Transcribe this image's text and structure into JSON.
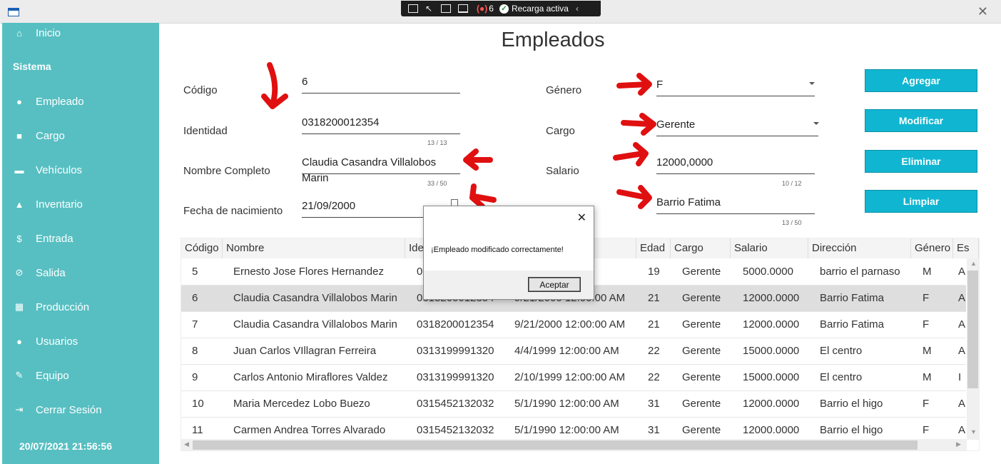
{
  "devbar": {
    "error_count": "6",
    "reload_label": "Recarga activa"
  },
  "sidebar": {
    "items": [
      {
        "label": "Inicio",
        "icon": "home-icon",
        "glyph": "⌂"
      },
      {
        "label": "Empleado",
        "icon": "person-icon",
        "glyph": "●"
      },
      {
        "label": "Cargo",
        "icon": "briefcase-icon",
        "glyph": "■"
      },
      {
        "label": "Vehículos",
        "icon": "truck-icon",
        "glyph": "▬"
      },
      {
        "label": "Inventario",
        "icon": "inventory-icon",
        "glyph": "▲"
      },
      {
        "label": "Entrada",
        "icon": "dollar-icon",
        "glyph": "$"
      },
      {
        "label": "Salida",
        "icon": "no-money-icon",
        "glyph": "⊘"
      },
      {
        "label": "Producción",
        "icon": "factory-icon",
        "glyph": "▦"
      },
      {
        "label": "Usuarios",
        "icon": "user-icon",
        "glyph": "●"
      },
      {
        "label": "Equipo",
        "icon": "wrench-icon",
        "glyph": "✎"
      },
      {
        "label": "Cerrar Sesión",
        "icon": "logout-icon",
        "glyph": "⇥"
      }
    ],
    "section_title": "Sistema",
    "datetime": "20/07/2021 21:56:56",
    "bg_color": "#57bfc2"
  },
  "page": {
    "title": "Empleados"
  },
  "form": {
    "codigo": {
      "label": "Código",
      "value": "6"
    },
    "identidad": {
      "label": "Identidad",
      "value": "0318200012354",
      "counter": "13 / 13"
    },
    "nombre": {
      "label": "Nombre Completo",
      "value": "Claudia Casandra Villalobos Marin",
      "counter": "33 / 50"
    },
    "fecha": {
      "label": "Fecha de nacimiento",
      "value": "21/09/2000"
    },
    "genero": {
      "label": "Género",
      "value": "F"
    },
    "cargo": {
      "label": "Cargo",
      "value": "Gerente"
    },
    "salario": {
      "label": "Salario",
      "value": "12000,0000",
      "counter": "10 / 12"
    },
    "direccion": {
      "value": "Barrio Fatima",
      "counter": "13 / 50"
    }
  },
  "buttons": {
    "agregar": "Agregar",
    "modificar": "Modificar",
    "eliminar": "Eliminar",
    "limpiar": "Limpiar",
    "color": "#10b6d1"
  },
  "table": {
    "headers": [
      "Código",
      "Nombre",
      "Ide",
      "Edad",
      "Cargo",
      "Salario",
      "Dirección",
      "Género",
      "Es"
    ],
    "rows": [
      {
        "codigo": "5",
        "nombre": "Ernesto Jose  Flores Hernandez",
        "identidad": "0",
        "fecha": ":00 AM",
        "edad": "19",
        "cargo": "Gerente",
        "salario": "5000.0000",
        "direccion": "barrio el parnaso",
        "genero": "M",
        "es": "A"
      },
      {
        "codigo": "6",
        "nombre": "Claudia Casandra Villalobos Marin",
        "identidad": "0318200012354",
        "fecha": "9/21/2000 12:00:00 AM",
        "edad": "21",
        "cargo": "Gerente",
        "salario": "12000.0000",
        "direccion": "Barrio Fatima",
        "genero": "F",
        "es": "A"
      },
      {
        "codigo": "7",
        "nombre": "Claudia Casandra Villalobos Marin",
        "identidad": "0318200012354",
        "fecha": "9/21/2000 12:00:00 AM",
        "edad": "21",
        "cargo": "Gerente",
        "salario": "12000.0000",
        "direccion": "Barrio Fatima",
        "genero": "F",
        "es": "A"
      },
      {
        "codigo": "8",
        "nombre": "Juan Carlos VIllagran Ferreira",
        "identidad": "0313199991320",
        "fecha": "4/4/1999 12:00:00 AM",
        "edad": "22",
        "cargo": "Gerente",
        "salario": "15000.0000",
        "direccion": "El centro",
        "genero": "M",
        "es": "A"
      },
      {
        "codigo": "9",
        "nombre": "Carlos Antonio Miraflores Valdez",
        "identidad": "0313199991320",
        "fecha": "2/10/1999 12:00:00 AM",
        "edad": "22",
        "cargo": "Gerente",
        "salario": "15000.0000",
        "direccion": "El centro",
        "genero": "M",
        "es": "I"
      },
      {
        "codigo": "10",
        "nombre": "Maria Mercedez Lobo Buezo",
        "identidad": "0315452132032",
        "fecha": "5/1/1990 12:00:00 AM",
        "edad": "31",
        "cargo": "Gerente",
        "salario": "12000.0000",
        "direccion": "Barrio el higo",
        "genero": "F",
        "es": "A"
      },
      {
        "codigo": "11",
        "nombre": "Carmen Andrea Torres Alvarado",
        "identidad": "0315452132032",
        "fecha": "5/1/1990 12:00:00 AM",
        "edad": "31",
        "cargo": "Gerente",
        "salario": "12000.0000",
        "direccion": "Barrio el higo",
        "genero": "F",
        "es": "A"
      }
    ]
  },
  "dialog": {
    "message": "¡Empleado modificado correctamente!",
    "button": "Aceptar"
  },
  "annotation_color": "#e01010"
}
